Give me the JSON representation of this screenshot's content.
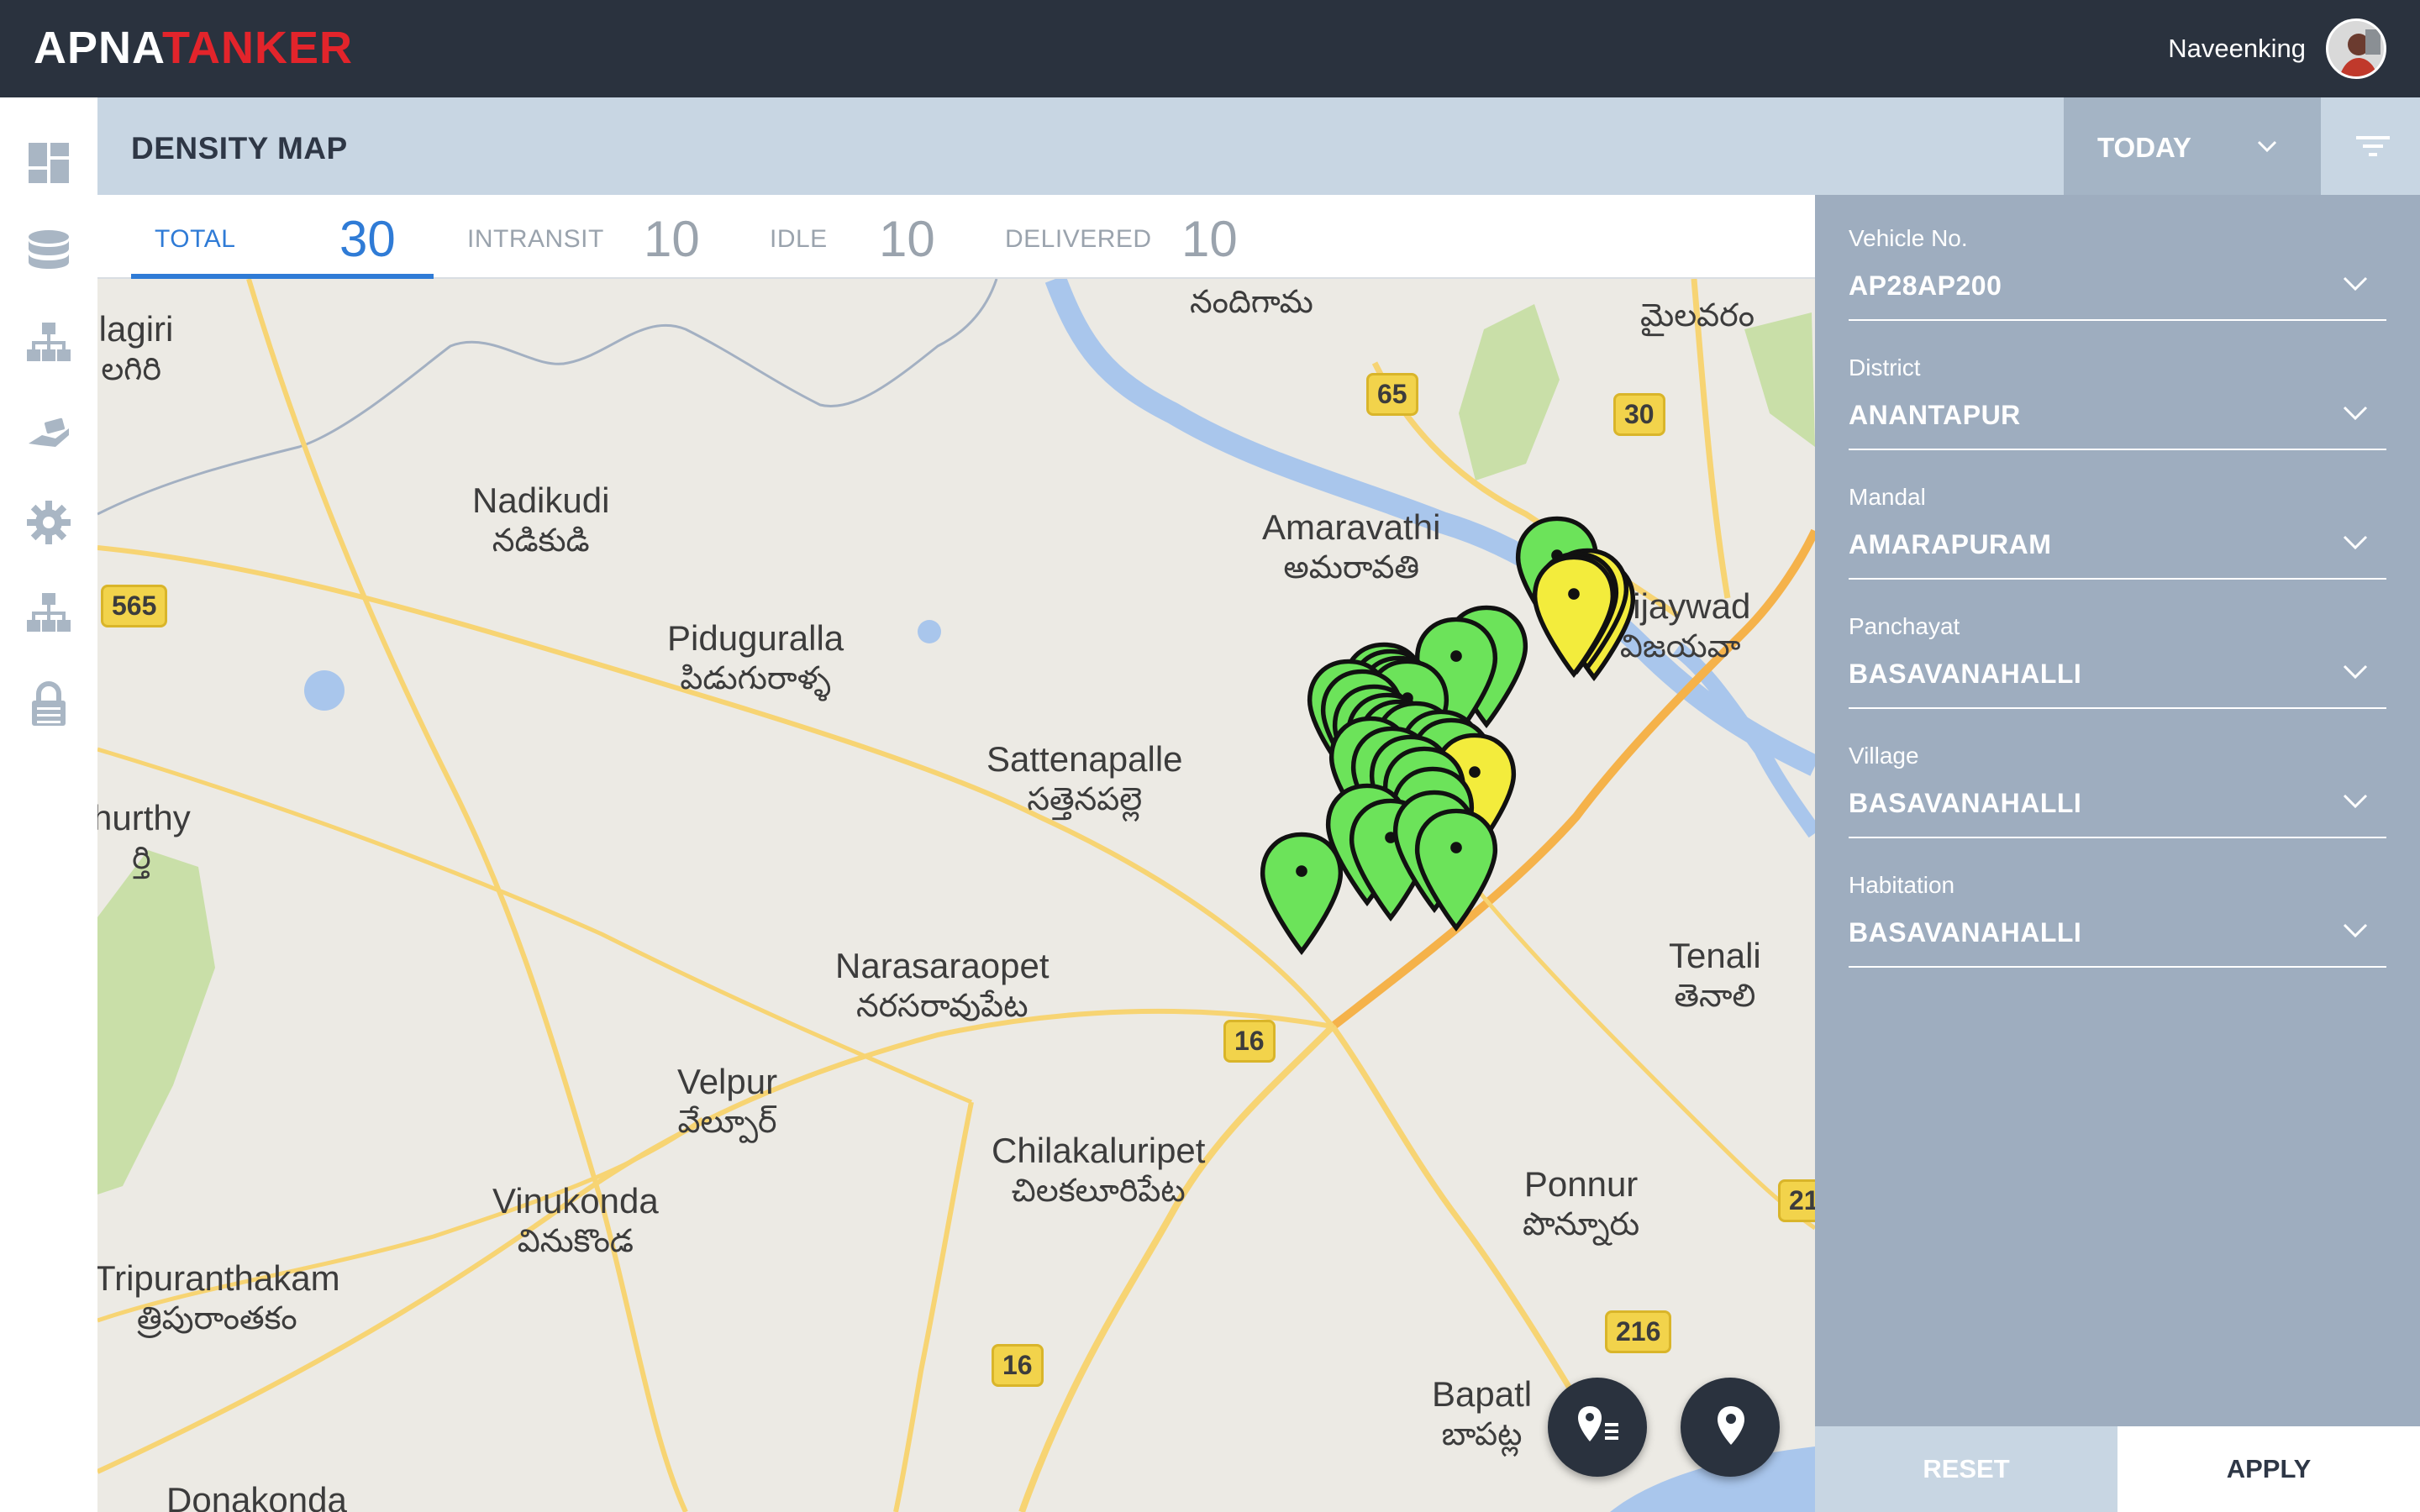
{
  "app": {
    "logo_part1": "APNA",
    "logo_part2": "TANKER",
    "username": "Naveenking"
  },
  "colors": {
    "topbar": "#2a323e",
    "accent": "#e3242b",
    "active_tab": "#2f7bd6",
    "panel": "#9eadbf",
    "pin_green": "#6ce35a",
    "pin_yellow": "#f3ec3c"
  },
  "sidebar": {
    "items": [
      {
        "icon": "dashboard-icon"
      },
      {
        "icon": "database-icon"
      },
      {
        "icon": "hierarchy-icon"
      },
      {
        "icon": "hand-truck-icon"
      },
      {
        "icon": "gear-icon"
      },
      {
        "icon": "org-chart-icon"
      },
      {
        "icon": "lock-icon"
      }
    ]
  },
  "header": {
    "title": "DENSITY MAP",
    "date_filter": "TODAY"
  },
  "stats": [
    {
      "label": "TOTAL",
      "value": "30"
    },
    {
      "label": "INTRANSIT",
      "value": "10"
    },
    {
      "label": "IDLE",
      "value": "10"
    },
    {
      "label": "DELIVERED",
      "value": "10"
    }
  ],
  "map": {
    "places": [
      {
        "en": "ılagiri",
        "te": "లగిరి"
      },
      {
        "en": "Nadikudi",
        "te": "నడికుడి"
      },
      {
        "en": "Piduguralla",
        "te": "పిడుగురాళ్ళ"
      },
      {
        "en": "Amaravathi",
        "te": "అమరావతి"
      },
      {
        "en": "Sattenapalle",
        "te": "సత్తెనపల్లె"
      },
      {
        "en": "hurthy",
        "te": "ర్తి"
      },
      {
        "en": "Narasaraopet",
        "te": "నరసరావుపేట"
      },
      {
        "en": "Velpur",
        "te": "వేల్పూర్"
      },
      {
        "en": "Chilakaluripet",
        "te": "చిలకలూరిపేట"
      },
      {
        "en": "Vinukonda",
        "te": "వినుకొండ"
      },
      {
        "en": "Tripuranthakam",
        "te": "త్రిపురాంతకం"
      },
      {
        "en": "Ponnur",
        "te": "పొన్నూరు"
      },
      {
        "en": "Tenali",
        "te": "తెనాలి"
      },
      {
        "en": "Vijaywad",
        "te": "విజయవా"
      },
      {
        "en": "",
        "te": "నందిగామ"
      },
      {
        "en": "",
        "te": "మైలవరం"
      },
      {
        "en": "Bapatl",
        "te": "బాపట్ల"
      },
      {
        "en": "Donakonda",
        "te": ""
      }
    ],
    "shields": [
      "65",
      "30",
      "565",
      "16",
      "16",
      "216",
      "21"
    ]
  },
  "filters": {
    "fields": [
      {
        "label": "Vehicle No.",
        "value": "AP28AP200"
      },
      {
        "label": "District",
        "value": "ANANTAPUR"
      },
      {
        "label": "Mandal",
        "value": "AMARAPURAM"
      },
      {
        "label": "Panchayat",
        "value": "BASAVANAHALLI"
      },
      {
        "label": "Village",
        "value": "BASAVANAHALLI"
      },
      {
        "label": "Habitation",
        "value": "BASAVANAHALLI"
      }
    ],
    "reset_label": "RESET",
    "apply_label": "APPLY"
  }
}
